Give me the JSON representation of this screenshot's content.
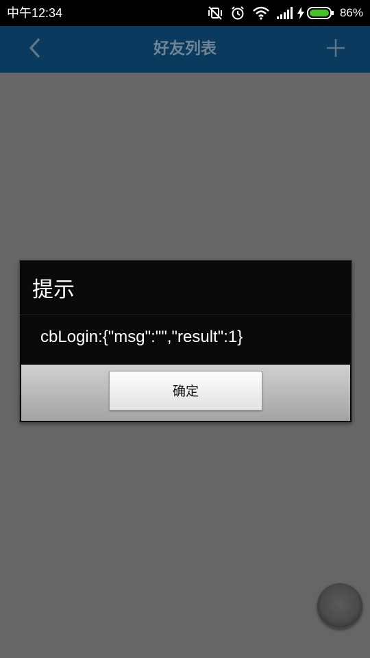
{
  "status_bar": {
    "time": "中午12:34",
    "battery_percent": "86%",
    "icons": [
      "vibrate-mute-icon",
      "alarm-icon",
      "wifi-icon",
      "signal-icon",
      "charging-icon",
      "battery-icon"
    ]
  },
  "header": {
    "title": "好友列表",
    "back_icon": "chevron-left-icon",
    "add_icon": "plus-icon",
    "background": "#0a3a5e"
  },
  "dialog": {
    "title": "提示",
    "message": "cbLogin:{\"msg\":\"\",\"result\":1}",
    "ok_label": "确定"
  },
  "floating_ball": {
    "icon": "assistive-ball-icon"
  },
  "colors": {
    "overlay": "#666666",
    "dialog_body": "#0a0a0a",
    "battery_fill": "#46c12a"
  }
}
